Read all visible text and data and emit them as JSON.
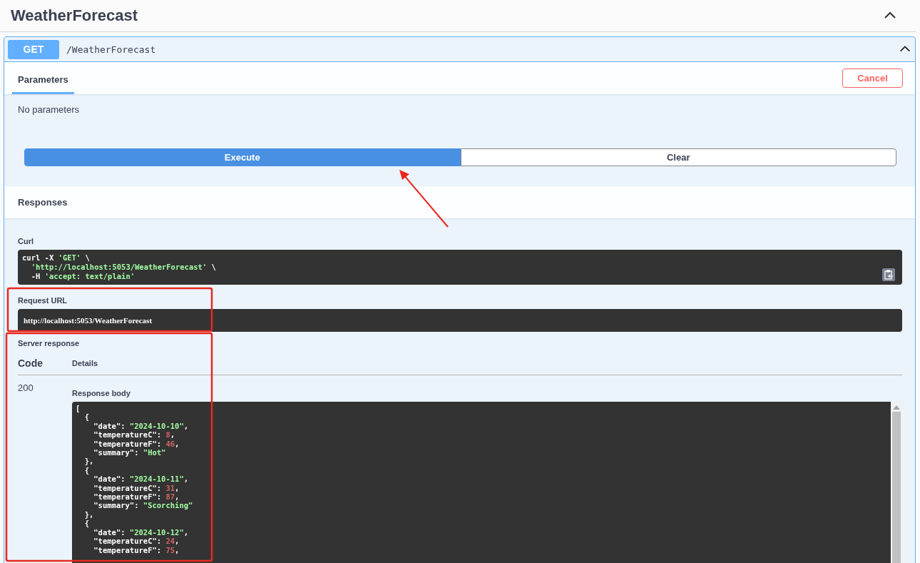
{
  "section": {
    "title": "WeatherForecast",
    "expanded": true
  },
  "operation": {
    "method": "GET",
    "path": "/WeatherForecast",
    "expanded": true
  },
  "tabs": [
    {
      "label": "Parameters",
      "selected": true
    }
  ],
  "cancel_button": "Cancel",
  "parameters_text": "No parameters",
  "buttons": [
    {
      "label": "Execute",
      "kind": "primary"
    },
    {
      "label": "Clear",
      "kind": "secondary"
    }
  ],
  "responses_title": "Responses",
  "curl": {
    "label": "Curl",
    "lines": [
      [
        {
          "text": "curl -X ",
          "kind": "plain"
        },
        {
          "text": "'GET'",
          "kind": "string"
        },
        {
          "text": " \\",
          "kind": "plain"
        }
      ],
      [
        {
          "text": "  'http://localhost:5053/WeatherForecast'",
          "kind": "string"
        },
        {
          "text": " \\",
          "kind": "plain"
        }
      ],
      [
        {
          "text": "  -H ",
          "kind": "plain"
        },
        {
          "text": "'accept: text/plain'",
          "kind": "string"
        }
      ]
    ]
  },
  "request_url": {
    "label": "Request URL",
    "value": "http://localhost:5053/WeatherForecast"
  },
  "server_response": {
    "label": "Server response",
    "columns": [
      "Code",
      "Details"
    ],
    "code": "200",
    "body_label": "Response body",
    "body_lines": [
      [
        {
          "text": "[",
          "kind": "plain"
        }
      ],
      [
        {
          "text": "  {",
          "kind": "plain"
        }
      ],
      [
        {
          "text": "    \"date\": ",
          "kind": "plain"
        },
        {
          "text": "\"2024-10-10\"",
          "kind": "string"
        },
        {
          "text": ",",
          "kind": "plain"
        }
      ],
      [
        {
          "text": "    \"temperatureC\": ",
          "kind": "plain"
        },
        {
          "text": "8",
          "kind": "number"
        },
        {
          "text": ",",
          "kind": "plain"
        }
      ],
      [
        {
          "text": "    \"temperatureF\": ",
          "kind": "plain"
        },
        {
          "text": "46",
          "kind": "number"
        },
        {
          "text": ",",
          "kind": "plain"
        }
      ],
      [
        {
          "text": "    \"summary\": ",
          "kind": "plain"
        },
        {
          "text": "\"Hot\"",
          "kind": "string"
        }
      ],
      [
        {
          "text": "  },",
          "kind": "plain"
        }
      ],
      [
        {
          "text": "  {",
          "kind": "plain"
        }
      ],
      [
        {
          "text": "    \"date\": ",
          "kind": "plain"
        },
        {
          "text": "\"2024-10-11\"",
          "kind": "string"
        },
        {
          "text": ",",
          "kind": "plain"
        }
      ],
      [
        {
          "text": "    \"temperatureC\": ",
          "kind": "plain"
        },
        {
          "text": "31",
          "kind": "number"
        },
        {
          "text": ",",
          "kind": "plain"
        }
      ],
      [
        {
          "text": "    \"temperatureF\": ",
          "kind": "plain"
        },
        {
          "text": "87",
          "kind": "number"
        },
        {
          "text": ",",
          "kind": "plain"
        }
      ],
      [
        {
          "text": "    \"summary\": ",
          "kind": "plain"
        },
        {
          "text": "\"Scorching\"",
          "kind": "string"
        }
      ],
      [
        {
          "text": "  },",
          "kind": "plain"
        }
      ],
      [
        {
          "text": "  {",
          "kind": "plain"
        }
      ],
      [
        {
          "text": "    \"date\": ",
          "kind": "plain"
        },
        {
          "text": "\"2024-10-12\"",
          "kind": "string"
        },
        {
          "text": ",",
          "kind": "plain"
        }
      ],
      [
        {
          "text": "    \"temperatureC\": ",
          "kind": "plain"
        },
        {
          "text": "24",
          "kind": "number"
        },
        {
          "text": ",",
          "kind": "plain"
        }
      ],
      [
        {
          "text": "    \"temperatureF\": ",
          "kind": "plain"
        },
        {
          "text": "75",
          "kind": "number"
        },
        {
          "text": ",",
          "kind": "plain"
        }
      ]
    ]
  }
}
